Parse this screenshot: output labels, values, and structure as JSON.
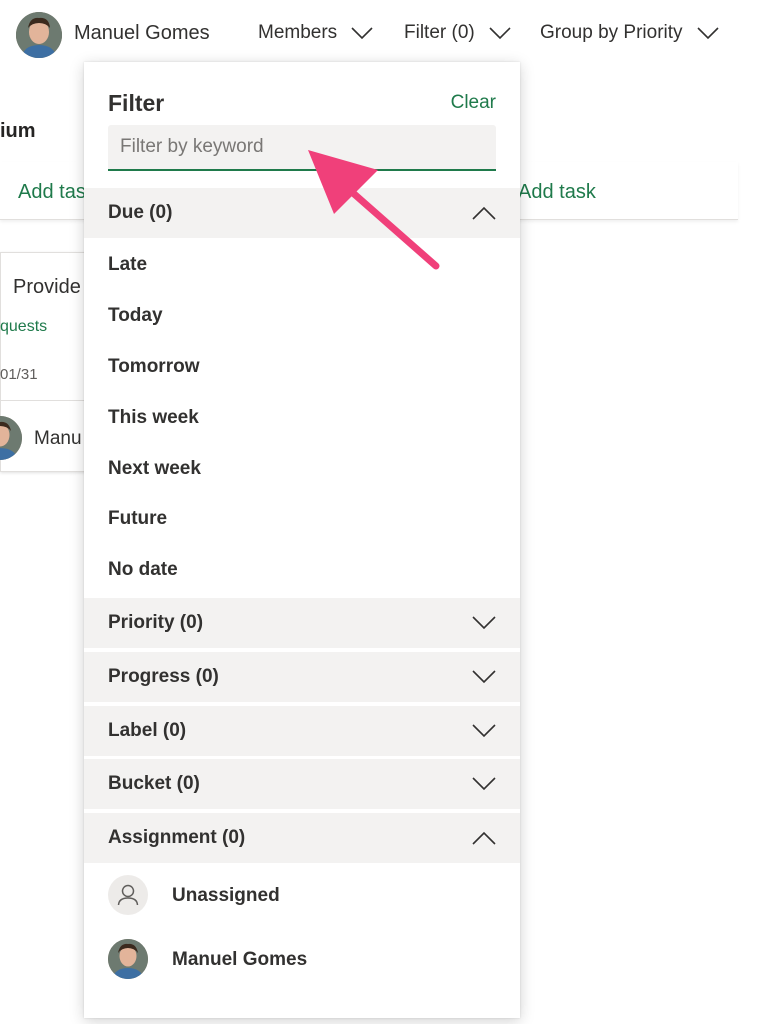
{
  "topbar": {
    "user_name": "Manuel Gomes",
    "members_label": "Members",
    "filter_label": "Filter (0)",
    "group_label": "Group by Priority"
  },
  "board": {
    "column_title_fragment": "ium",
    "add_task_left": "Add tas",
    "add_task_right": "Add task",
    "card": {
      "title_fragment": "Provide",
      "label_fragment": "quests",
      "date_fragment": "01/31",
      "user_fragment": "Manu"
    }
  },
  "filter_panel": {
    "title": "Filter",
    "clear_label": "Clear",
    "keyword_placeholder": "Filter by keyword",
    "keyword_value": "",
    "sections": {
      "due": {
        "label": "Due (0)",
        "expanded": true,
        "options": [
          "Late",
          "Today",
          "Tomorrow",
          "This week",
          "Next week",
          "Future",
          "No date"
        ]
      },
      "priority": {
        "label": "Priority (0)",
        "expanded": false
      },
      "progress": {
        "label": "Progress (0)",
        "expanded": false
      },
      "label": {
        "label": "Label (0)",
        "expanded": false
      },
      "bucket": {
        "label": "Bucket (0)",
        "expanded": false
      },
      "assignment": {
        "label": "Assignment (0)",
        "expanded": true,
        "options": [
          "Unassigned",
          "Manuel Gomes"
        ]
      }
    }
  },
  "icons": {
    "dropdown": "chevron-down-icon",
    "collapse": "chevron-up-icon",
    "unassigned": "person-icon",
    "annotation": "arrow-icon"
  },
  "colors": {
    "accent": "#1f7a4b",
    "section_bg": "#f3f2f1",
    "annotation": "#f0407a"
  }
}
